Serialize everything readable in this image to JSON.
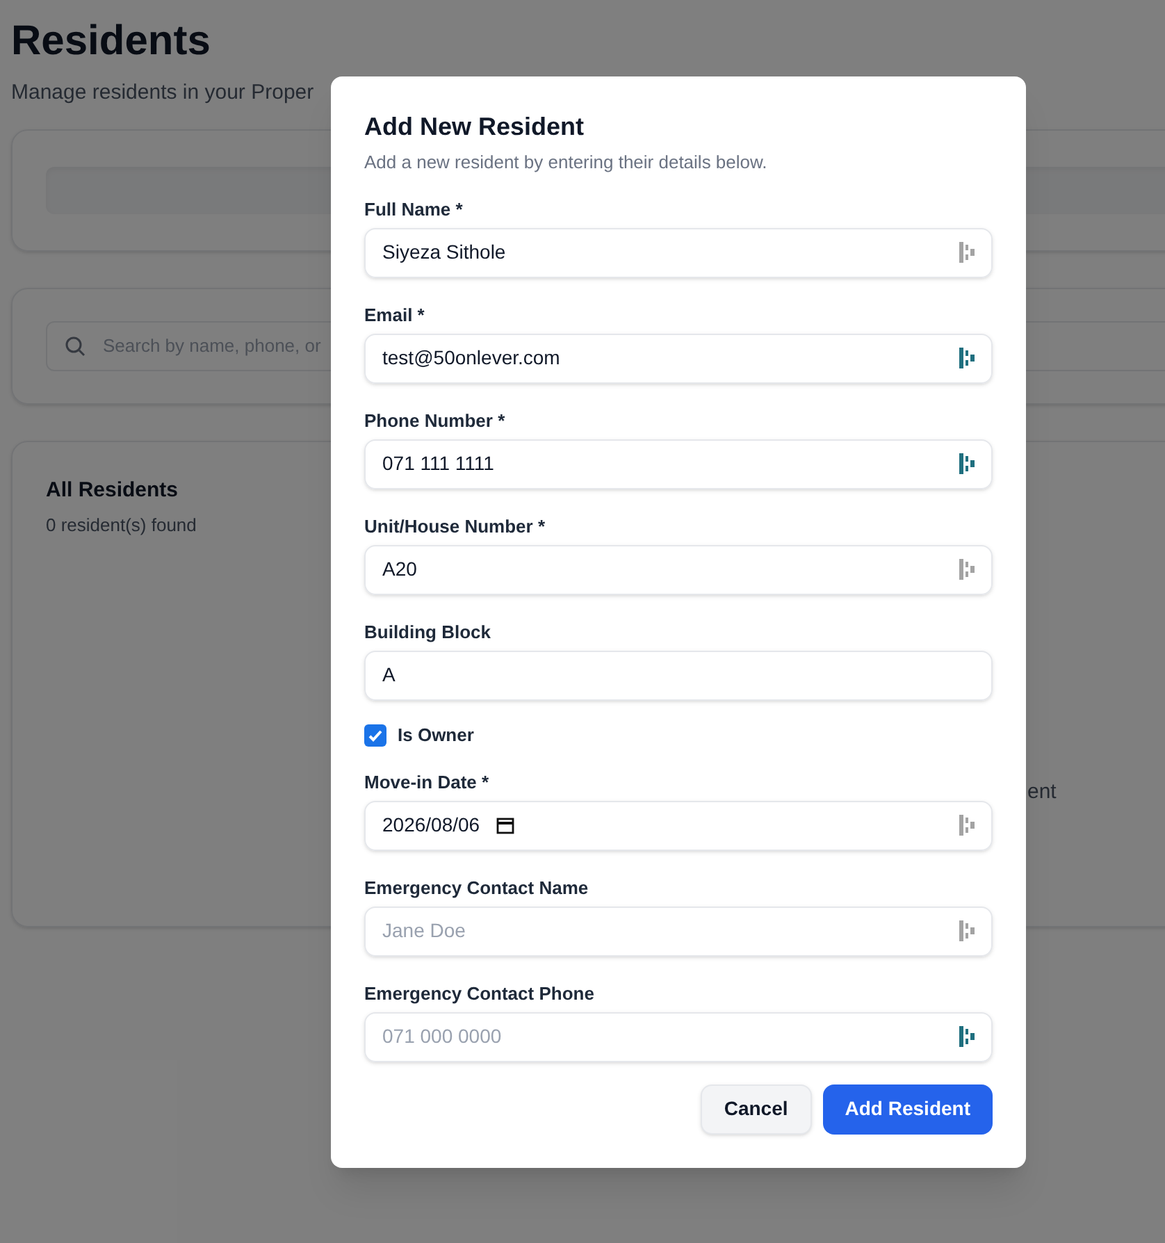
{
  "page": {
    "title": "Residents",
    "subtitle": "Manage residents in your Proper",
    "search": {
      "placeholder": "Search by name, phone, or"
    },
    "list": {
      "title": "All Residents",
      "count": "0 resident(s) found",
      "empty_fragment": "ent"
    }
  },
  "dialog": {
    "title": "Add New Resident",
    "description": "Add a new resident by entering their details below.",
    "fields": [
      {
        "kind": "text",
        "label": "Full Name *",
        "value": "Siyeza Sithole",
        "helper_active": false
      },
      {
        "kind": "text",
        "label": "Email *",
        "value": "test@50onlever.com",
        "helper_active": true
      },
      {
        "kind": "text",
        "label": "Phone Number *",
        "value": "071 111 1111",
        "helper_active": true
      },
      {
        "kind": "text",
        "label": "Unit/House Number *",
        "value": "A20",
        "helper_active": false
      },
      {
        "kind": "text",
        "label": "Building Block",
        "value": "A"
      },
      {
        "kind": "checkbox",
        "label": "Is Owner",
        "checked": true
      },
      {
        "kind": "date",
        "label": "Move-in Date *",
        "value": "2026/08/06",
        "helper_active": false
      },
      {
        "kind": "text",
        "label": "Emergency Contact Name",
        "placeholder": "Jane Doe",
        "helper_active": false
      },
      {
        "kind": "text",
        "label": "Emergency Contact Phone",
        "placeholder": "071 000 0000",
        "helper_active": true
      }
    ],
    "buttons": [
      {
        "kind": "secondary",
        "label": "Cancel"
      },
      {
        "kind": "primary",
        "label": "Add Resident"
      }
    ]
  }
}
